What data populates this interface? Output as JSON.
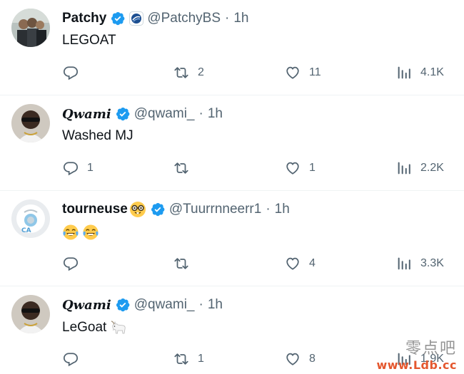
{
  "tweets": [
    {
      "name": "Patchy",
      "handle": "@PatchyBS",
      "sep": "·",
      "time": "1h",
      "text": "LEGOAT",
      "reply_count": "",
      "retweet_count": "2",
      "like_count": "11",
      "view_count": "4.1K"
    },
    {
      "name": "Qwami",
      "handle": "@qwami_",
      "sep": "·",
      "time": "1h",
      "text": "Washed MJ",
      "reply_count": "1",
      "retweet_count": "",
      "like_count": "1",
      "view_count": "2.2K"
    },
    {
      "name": "tourneuse",
      "handle": "@Tuurrnneerr1",
      "sep": "·",
      "time": "1h",
      "text": "",
      "emojis": [
        "face-with-tears-of-joy",
        "face-with-tears-of-joy"
      ],
      "reply_count": "",
      "retweet_count": "",
      "like_count": "4",
      "view_count": "3.3K"
    },
    {
      "name": "Qwami",
      "handle": "@qwami_",
      "sep": "·",
      "time": "1h",
      "text": "LeGoat",
      "reply_count": "",
      "retweet_count": "1",
      "like_count": "8",
      "view_count": "1.9K"
    }
  ],
  "colors": {
    "verified": "#1d9bf0",
    "muted": "#536471",
    "text": "#0f1419",
    "divider": "#eff3f4"
  },
  "watermark": {
    "chinese": "零点吧",
    "url": "www.Ldb.cc"
  }
}
